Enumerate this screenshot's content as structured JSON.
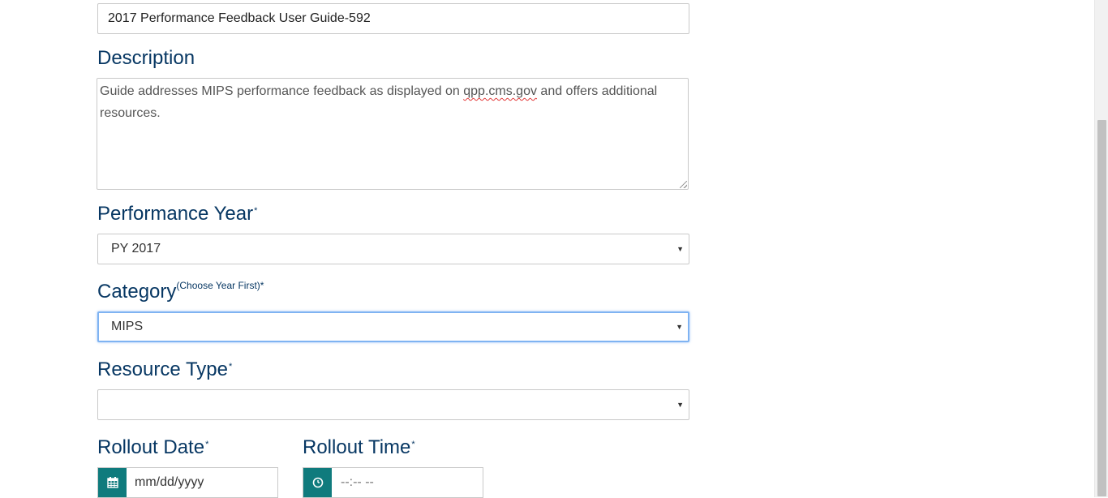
{
  "form": {
    "title_value": "2017 Performance Feedback User Guide-592",
    "description": {
      "label": "Description",
      "text_before": "Guide addresses MIPS performance feedback as displayed on ",
      "misspelled": "qpp.cms.gov",
      "text_after": " and offers additional resources."
    },
    "performance_year": {
      "label": "Performance Year",
      "required_mark": "*",
      "selected": "PY 2017"
    },
    "category": {
      "label": "Category",
      "note": "(Choose Year First)*",
      "selected": "MIPS"
    },
    "resource_type": {
      "label": "Resource Type",
      "required_mark": "*",
      "selected": ""
    },
    "rollout_date": {
      "label": "Rollout Date",
      "required_mark": "*",
      "placeholder": "mm/dd/yyyy"
    },
    "rollout_time": {
      "label": "Rollout Time",
      "required_mark": "*",
      "placeholder": "--:-- --"
    }
  },
  "icons": {
    "date": "calendar-icon",
    "time": "clock-icon",
    "select_caret": "caret-down-icon"
  },
  "colors": {
    "label": "#073763",
    "addon": "#0f7b7d",
    "focus_border": "#7fb3f2",
    "spellcheck": "#e23b3b"
  }
}
